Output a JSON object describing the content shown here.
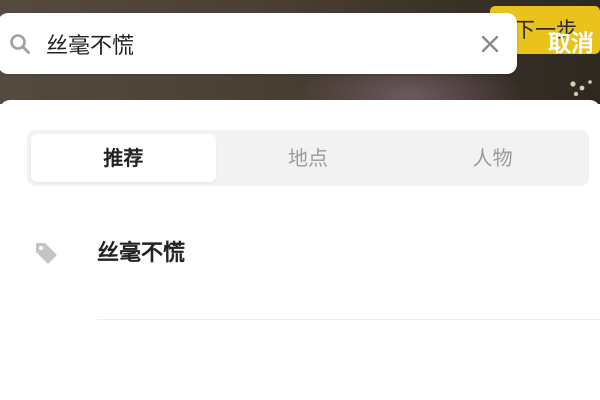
{
  "header": {
    "next_button_label": "下一步",
    "cancel_label": "取消"
  },
  "search": {
    "value": "丝毫不慌",
    "search_icon": "search-icon",
    "clear_icon": "close-icon"
  },
  "tabs": [
    {
      "label": "推荐",
      "active": true
    },
    {
      "label": "地点",
      "active": false
    },
    {
      "label": "人物",
      "active": false
    }
  ],
  "suggestions": [
    {
      "icon": "tag-icon",
      "label": "丝毫不慌"
    }
  ],
  "colors": {
    "accent_yellow": "#e9c21b",
    "text_primary": "#222222",
    "text_secondary": "#9b9b9b",
    "tab_background": "#f2f2f2"
  }
}
